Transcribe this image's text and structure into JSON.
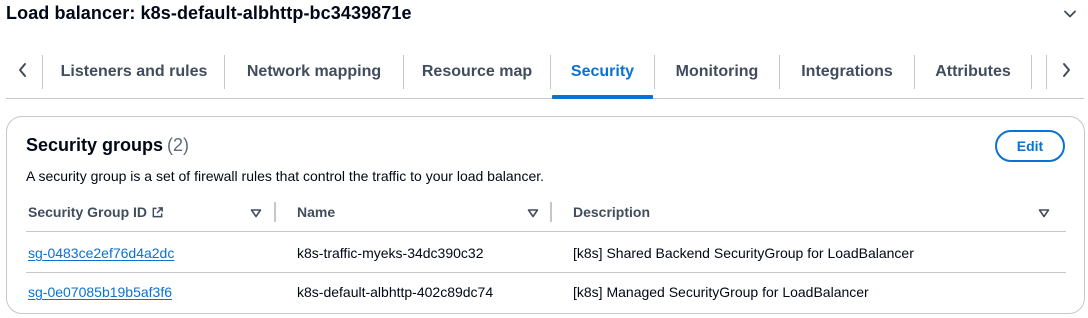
{
  "header": {
    "title": "Load balancer: k8s-default-albhttp-bc3439871e"
  },
  "tabs": [
    {
      "label": "Listeners and rules",
      "active": false
    },
    {
      "label": "Network mapping",
      "active": false
    },
    {
      "label": "Resource map",
      "active": false
    },
    {
      "label": "Security",
      "active": true
    },
    {
      "label": "Monitoring",
      "active": false
    },
    {
      "label": "Integrations",
      "active": false
    },
    {
      "label": "Attributes",
      "active": false
    }
  ],
  "security_groups": {
    "title": "Security groups",
    "count": "(2)",
    "description": "A security group is a set of firewall rules that control the traffic to your load balancer.",
    "edit_label": "Edit",
    "columns": [
      "Security Group ID",
      "Name",
      "Description"
    ],
    "rows": [
      {
        "id": "sg-0483ce2ef76d4a2dc",
        "name": "k8s-traffic-myeks-34dc390c32",
        "description": "[k8s] Shared Backend SecurityGroup for LoadBalancer"
      },
      {
        "id": "sg-0e07085b19b5af3f6",
        "name": "k8s-default-albhttp-402c89dc74",
        "description": "[k8s] Managed SecurityGroup for LoadBalancer"
      }
    ]
  },
  "colors": {
    "accent": "#0972d3",
    "text": "#000716",
    "muted": "#414d5c",
    "border": "#c6c6cd"
  },
  "icons": {
    "collapse": "chevron-down-icon",
    "scroll_left": "chevron-left-icon",
    "scroll_right": "chevron-right-icon",
    "external": "external-link-icon",
    "sort": "caret-down-icon"
  }
}
